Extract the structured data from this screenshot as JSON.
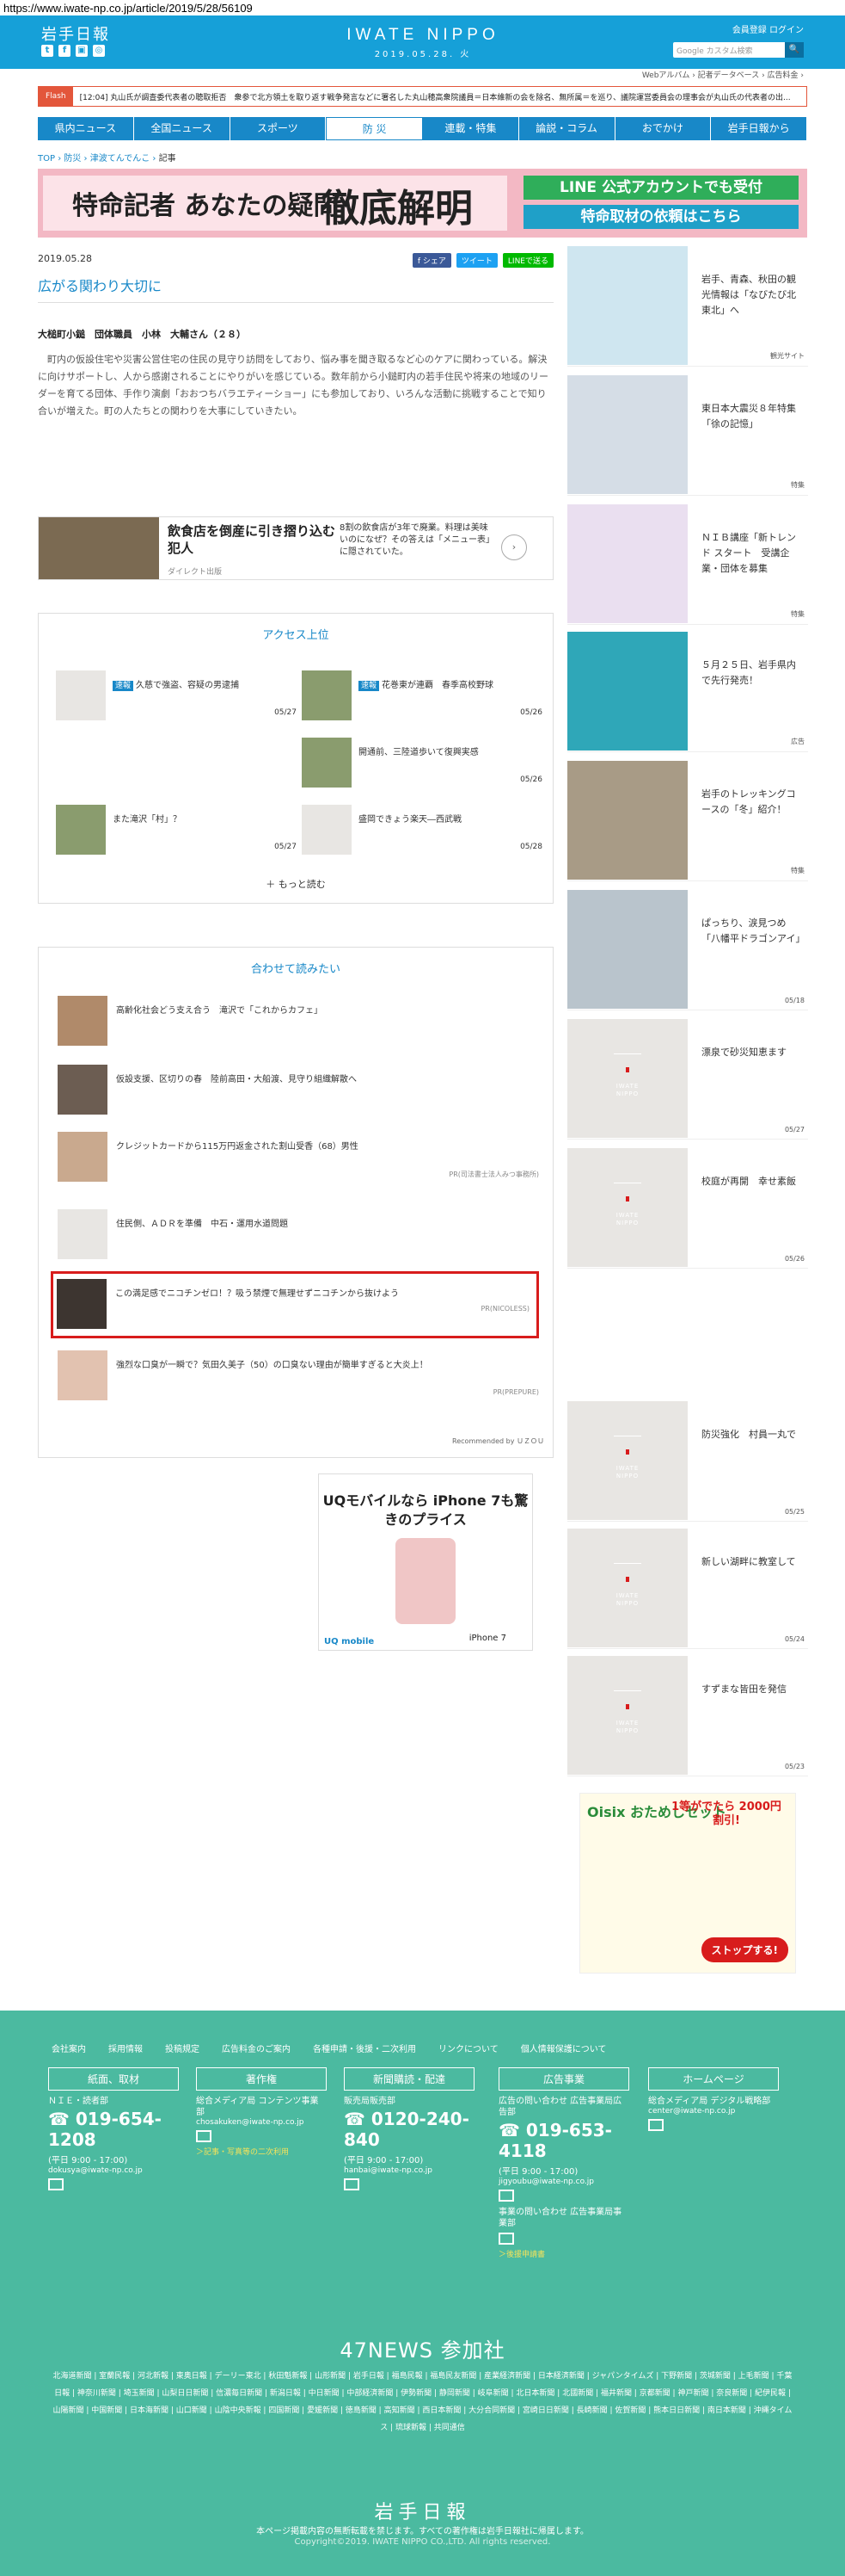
{
  "url": "https://www.iwate-np.co.jp/article/2019/5/28/56109",
  "header": {
    "logo_jp": "岩手日報",
    "brand": "IWATE NIPPO",
    "date": "2019.05.28. 火",
    "top_links": "会員登録  ログイン",
    "search_placeholder": "Google カスタム検索",
    "search_btn": "🔍",
    "sub_links": "Webアルバム ›  記者データベース ›  広告料金 ›",
    "social": [
      "t",
      "f",
      "▣",
      "◎"
    ]
  },
  "flash": {
    "tag": "Flash",
    "text": "[12:04] 丸山氏が調査委代表者の聴取拒否　衆参で北方領土を取り返す戦争発言などに署名した丸山穂高衆院議員＝日本維新の会を除名、無所属＝を巡り、議院運営委員会の理事会が丸山氏の代表者の出..."
  },
  "nav": [
    "県内ニュース",
    "全国ニュース",
    "スポーツ",
    "防 災",
    "連載・特集",
    "論説・コラム",
    "おでかけ",
    "岩手日報から"
  ],
  "breadcrumb": {
    "items": [
      "TOP",
      "防災",
      "津波てんでんこ"
    ],
    "current": "記事",
    "sep": " › "
  },
  "banner": {
    "left": "特命記者 あなたの疑問",
    "big": "徹底解明",
    "r1": "LINE 公式アカウントでも受付",
    "r2": "特命取材の依頼はこちら"
  },
  "article": {
    "date": "2019.05.28",
    "share": [
      "f シェア",
      "ツイート",
      "LINEで送る"
    ],
    "title": "広がる関わり大切に",
    "byline": "大槌町小鎚　団体職員　小林　大輔さん（２８）",
    "body": "町内の仮設住宅や災害公営住宅の住民の見守り訪問をしており、悩み事を聞き取るなど心のケアに関わっている。解決に向けサポートし、人から感謝されることにやりがいを感じている。数年前から小鎚町内の若手住民や将来の地域のリーダーを育てる団体、手作り演劇「おおつちバラエティーショー」にも参加しており、いろんな活動に挑戦することで知り合いが増えた。町の人たちとの関わりを大事にしていきたい。"
  },
  "ad1": {
    "t1": "飲食店を倒産に引き摺り込む犯人",
    "t2": "ダイレクト出版",
    "t3": "8割の飲食店が3年で廃業。料理は美味いのになぜ？その答えは「メニュー表」に隠されていた。",
    "arrow": "›"
  },
  "access": {
    "title": "アクセス上位",
    "items": [
      {
        "badge": "速報",
        "text": "久慈で強盗、容疑の男逮捕",
        "date": "05/27"
      },
      {
        "badge": "速報",
        "text": "花巻東が連覇　春季高校野球",
        "date": "05/26"
      },
      {
        "badge": "",
        "text": "開通前、三陸道歩いて復興実感",
        "date": "05/26"
      },
      {
        "badge": "",
        "text": "また滝沢「村」？",
        "date": "05/27"
      },
      {
        "badge": "",
        "text": "盛岡できょう楽天―西武戦",
        "date": "05/28"
      }
    ],
    "more": "＋ もっと読む"
  },
  "related": {
    "title": "合わせて読みたい",
    "items": [
      {
        "text": "高齢化社会どう支え合う　滝沢で「これからカフェ」",
        "pr": ""
      },
      {
        "text": "仮設支援、区切りの春　陸前高田・大船渡、見守り組織解散へ",
        "pr": ""
      },
      {
        "text": "クレジットカードから115万円返金された割山受香（68）男性",
        "pr": "PR(司法書士法人みつ事務所)"
      },
      {
        "text": "住民側、ＡＤＲを準備　中石・運用水道問題",
        "pr": ""
      },
      {
        "text": "この満足感でニコチンゼロ！？吸う禁煙で無理せずニコチンから抜けよう",
        "pr": "PR(NICOLESS)"
      },
      {
        "text": "強烈な口臭が一瞬で？気田久美子（50）の口臭ない理由が簡単すぎると大炎上！",
        "pr": "PR(PREPURE)"
      }
    ],
    "rec": "Recommended by ＵＺＯＵ"
  },
  "ad2": {
    "t": "UQモバイルなら iPhone 7も驚きのプライス",
    "logo": "UQ mobile",
    "iphone": " iPhone 7"
  },
  "sidebar": [
    {
      "text": "岩手、青森、秋田の観光情報は「なびたび北東北」へ",
      "small": "観光サイト"
    },
    {
      "text": "東日本大震災８年特集「徐の記憶」",
      "small": "特集"
    },
    {
      "text": "ＮＩＢ講座「新トレンド スタート　受講企業・団体を募集",
      "small": "特集"
    },
    {
      "text": "５月２５日、岩手県内で先行発売！",
      "small": "広告"
    },
    {
      "text": "岩手のトレッキングコースの「冬」紹介！",
      "small": "特集"
    },
    {
      "text": "ぱっちり、涙見つめ　「八幡平ドラゴンアイ」",
      "small": "05/18"
    },
    {
      "text": "漂泉で砂災知恵ます",
      "small": "05/27"
    },
    {
      "text": "校庭が再開　幸せ素飯",
      "small": "05/26"
    },
    {
      "text": "防災強化　村員一丸で",
      "small": "05/25"
    },
    {
      "text": "新しい湖畔に教室して",
      "small": "05/24"
    },
    {
      "text": "すずまな皆田を発信",
      "small": "05/23"
    }
  ],
  "placeholder_logo": "IWATE NIPPO",
  "ad3": {
    "t1": "Oisix おためしセット",
    "t2": "1等がでたら 2000円割引!",
    "btn": "ストップする!"
  },
  "footer": {
    "links": [
      "会社案内",
      "採用情報",
      "投稿規定",
      "広告料金のご案内",
      "各種申請・後援・二次利用",
      "リンクについて",
      "個人情報保護について"
    ],
    "cols": [
      {
        "hd": "紙面、取材",
        "l1": "ＮＩＥ・読者部",
        "ph": "☎ 019-654-1208",
        "l2": "(平日 9:00 - 17:00)",
        "em": "dokusya@iwate-np.co.jp",
        "yl": ""
      },
      {
        "hd": "著作権",
        "l1": "総合メディア局 コンテンツ事業部",
        "ph": "",
        "l2": "",
        "em": "chosakuken@iwate-np.co.jp",
        "yl": "＞記事・写真等の二次利用"
      },
      {
        "hd": "新聞購読・配達",
        "l1": "販売局販売部",
        "ph": "☎ 0120-240-840",
        "l2": "(平日 9:00 - 17:00)",
        "em": "hanbai@iwate-np.co.jp",
        "yl": ""
      },
      {
        "hd": "広告事業",
        "l1": "広告の問い合わせ 広告事業局広告部",
        "ph": "☎ 019-653-4118",
        "l2": "(平日 9:00 - 17:00)",
        "em": "jigyoubu@iwate-np.co.jp",
        "yl": "＞後援申請書"
      },
      {
        "hd": "ホームページ",
        "l1": "総合メディア局 デジタル戦略部",
        "ph": "",
        "l2": "",
        "em": "center@iwate-np.co.jp",
        "yl": ""
      }
    ],
    "jigyou_l": "事業の問い合わせ 広告事業局事業部",
    "n47": "47NEWS 参加社",
    "papers": "北海道新聞 | 室蘭民報 | 河北新報 | 東奥日報 | デーリー東北 | 秋田魁新報 | 山形新聞 | 岩手日報 | 福島民報 | 福島民友新聞 | 産業経済新聞 | 日本経済新聞 | ジャパンタイムズ | 下野新聞 | 茨城新聞 | 上毛新聞 | 千葉日報 | 神奈川新聞 | 埼玉新聞 | 山梨日日新聞 | 信濃毎日新聞 | 新潟日報 | 中日新聞 | 中部経済新聞 | 伊勢新聞 | 静岡新聞 | 岐阜新聞 | 北日本新聞 | 北國新聞 | 福井新聞 | 京都新聞 | 神戸新聞 | 奈良新聞 | 紀伊民報 | 山陽新聞 | 中国新聞 | 日本海新聞 | 山口新聞 | 山陰中央新報 | 四国新聞 | 愛媛新聞 | 徳島新聞 | 高知新聞 | 西日本新聞 | 大分合同新聞 | 宮崎日日新聞 | 長崎新聞 | 佐賀新聞 | 熊本日日新聞 | 南日本新聞 | 沖縄タイムス | 琉球新報 | 共同通信",
    "logo": "岩手日報",
    "note": "本ページ掲載内容の無断転載を禁じます。すべての著作権は岩手日報社に帰属します。",
    "copy": "Copyright©2019. IWATE NIPPO CO.,LTD. All rights reserved."
  }
}
